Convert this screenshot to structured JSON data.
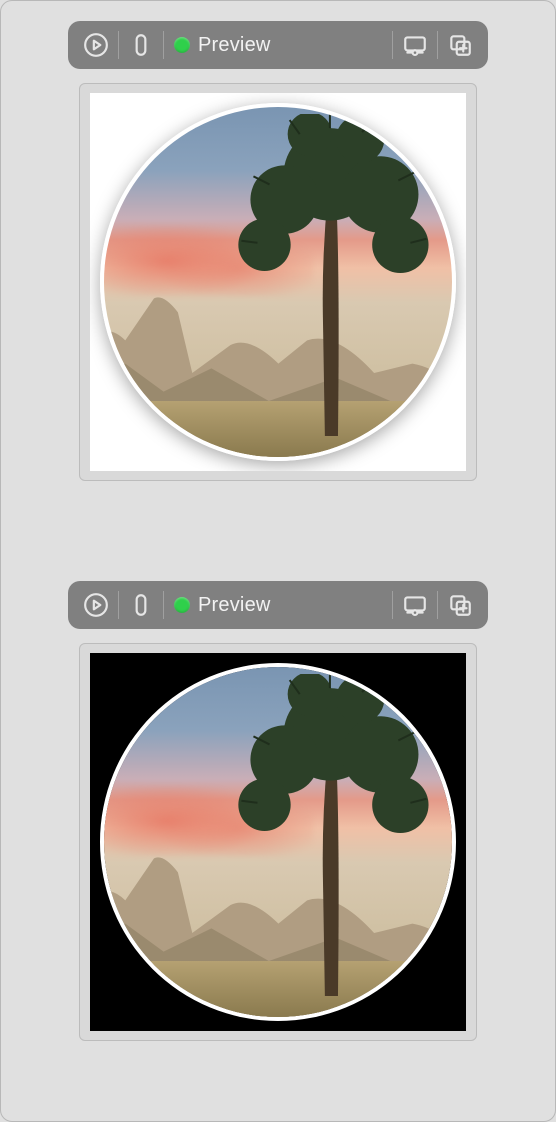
{
  "previews": [
    {
      "toolbar": {
        "run_icon": "play-icon",
        "device_icon": "device-icon",
        "status_color": "#2fd04b",
        "label": "Preview",
        "display_icon": "display-settings-icon",
        "duplicate_icon": "duplicate-icon"
      },
      "canvas": {
        "background": "white",
        "content": "circular-masked-landscape"
      }
    },
    {
      "toolbar": {
        "run_icon": "play-icon",
        "device_icon": "device-icon",
        "status_color": "#2fd04b",
        "label": "Preview",
        "display_icon": "display-settings-icon",
        "duplicate_icon": "duplicate-icon"
      },
      "canvas": {
        "background": "black",
        "content": "circular-masked-landscape"
      }
    }
  ]
}
